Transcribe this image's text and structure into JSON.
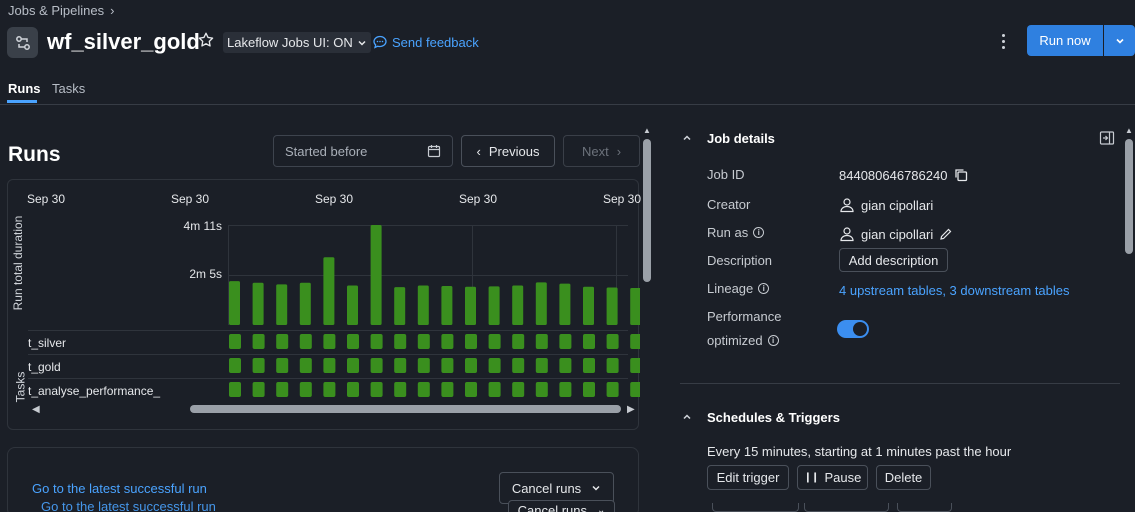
{
  "breadcrumb": {
    "parent": "Jobs & Pipelines"
  },
  "header": {
    "title": "wf_silver_gold",
    "ui_toggle_label": "Lakeflow Jobs UI: ON",
    "feedback_label": "Send feedback",
    "run_now_label": "Run now"
  },
  "tabs": [
    {
      "label": "Runs",
      "active": true
    },
    {
      "label": "Tasks",
      "active": false
    }
  ],
  "runs": {
    "heading": "Runs",
    "filter_placeholder": "Started before",
    "previous_label": "Previous",
    "next_label": "Next"
  },
  "chart_data": {
    "type": "bar",
    "ylabel": "Run total duration",
    "yticks": [
      "4m 11s",
      "2m 5s"
    ],
    "ytick_values_seconds": [
      251,
      125
    ],
    "date_labels": [
      "Sep 30",
      "Sep 30",
      "Sep 30",
      "Sep 30",
      "Sep 30"
    ],
    "values_seconds": [
      110,
      106,
      102,
      106,
      170,
      99,
      251,
      95,
      99,
      98,
      96,
      97,
      99,
      107,
      104,
      96,
      94,
      93
    ],
    "status_color": "#3a8f1e",
    "tasks_label": "Tasks",
    "tasks": [
      "t_silver",
      "t_gold",
      "t_analyse_performance_"
    ],
    "ylim": [
      0,
      251
    ]
  },
  "bottom": {
    "latest_link": "Go to the latest successful run",
    "cancel_label": "Cancel runs"
  },
  "job_details": {
    "title": "Job details",
    "fields": [
      {
        "label": "Job ID",
        "value": "844080646786240"
      },
      {
        "label": "Creator",
        "value": "gian cipollari"
      },
      {
        "label": "Run as",
        "value": "gian cipollari"
      },
      {
        "label": "Description",
        "value": "Add description"
      },
      {
        "label": "Lineage",
        "value": "4 upstream tables, 3 downstream tables"
      },
      {
        "label": "Performance",
        "label2": "optimized",
        "value": "on"
      }
    ]
  },
  "schedules": {
    "title": "Schedules & Triggers",
    "summary": "Every 15 minutes, starting at 1 minutes past the hour",
    "edit_label": "Edit trigger",
    "pause_label": "Pause",
    "delete_label": "Delete"
  },
  "colors": {
    "accent": "#2f80e0",
    "link": "#4aa3ff",
    "success": "#3a8f1e",
    "background": "#1b1f27"
  }
}
